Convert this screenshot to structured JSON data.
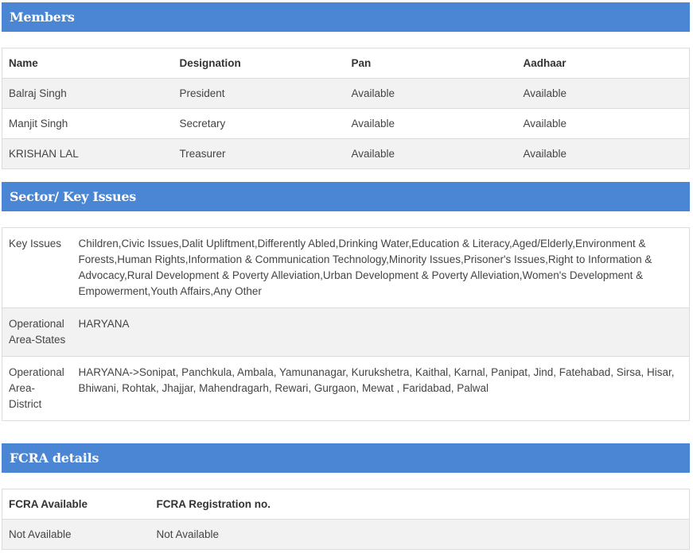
{
  "members": {
    "title": "Members",
    "headers": [
      "Name",
      "Designation",
      "Pan",
      "Aadhaar"
    ],
    "rows": [
      [
        "Balraj Singh",
        "President",
        "Available",
        "Available"
      ],
      [
        "Manjit Singh",
        "Secretary",
        "Available",
        "Available"
      ],
      [
        "KRISHAN LAL",
        "Treasurer",
        "Available",
        "Available"
      ]
    ]
  },
  "sector": {
    "title": "Sector/ Key Issues",
    "rows": [
      {
        "label": "Key Issues",
        "value": "Children,Civic Issues,Dalit Upliftment,Differently Abled,Drinking Water,Education & Literacy,Aged/Elderly,Environment & Forests,Human Rights,Information & Communication Technology,Minority Issues,Prisoner's Issues,Right to Information & Advocacy,Rural Development & Poverty Alleviation,Urban Development & Poverty Alleviation,Women's Development & Empowerment,Youth Affairs,Any Other"
      },
      {
        "label": "Operational Area-States",
        "value": "HARYANA"
      },
      {
        "label": "Operational Area-District",
        "value": "HARYANA->Sonipat, Panchkula, Ambala, Yamunanagar, Kurukshetra, Kaithal, Karnal, Panipat, Jind, Fatehabad, Sirsa, Hisar, Bhiwani, Rohtak, Jhajjar, Mahendragarh, Rewari, Gurgaon, Mewat , Faridabad, Palwal"
      }
    ]
  },
  "fcra": {
    "title": "FCRA details",
    "headers": [
      "FCRA Available",
      "FCRA Registration no."
    ],
    "rows": [
      [
        "Not Available",
        "Not Available"
      ]
    ]
  }
}
